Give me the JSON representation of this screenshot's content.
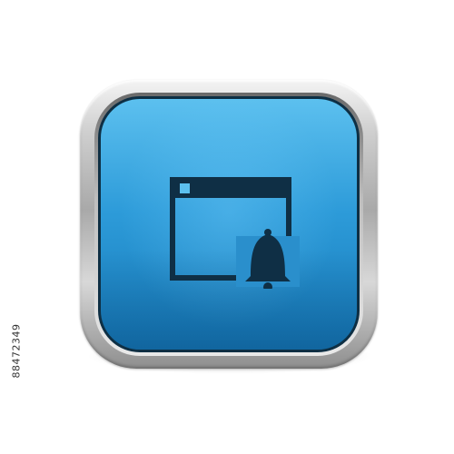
{
  "icon": {
    "symbol": "browser-window-notification-bell-icon",
    "bezel_style": "metallic silver rounded square",
    "face_color": "#2d9bd9",
    "face_color_top": "#5cc0ef",
    "face_color_bottom": "#167ab9",
    "glyph_color": "#0f2f45"
  },
  "watermark": {
    "stock_id": "88472349"
  }
}
